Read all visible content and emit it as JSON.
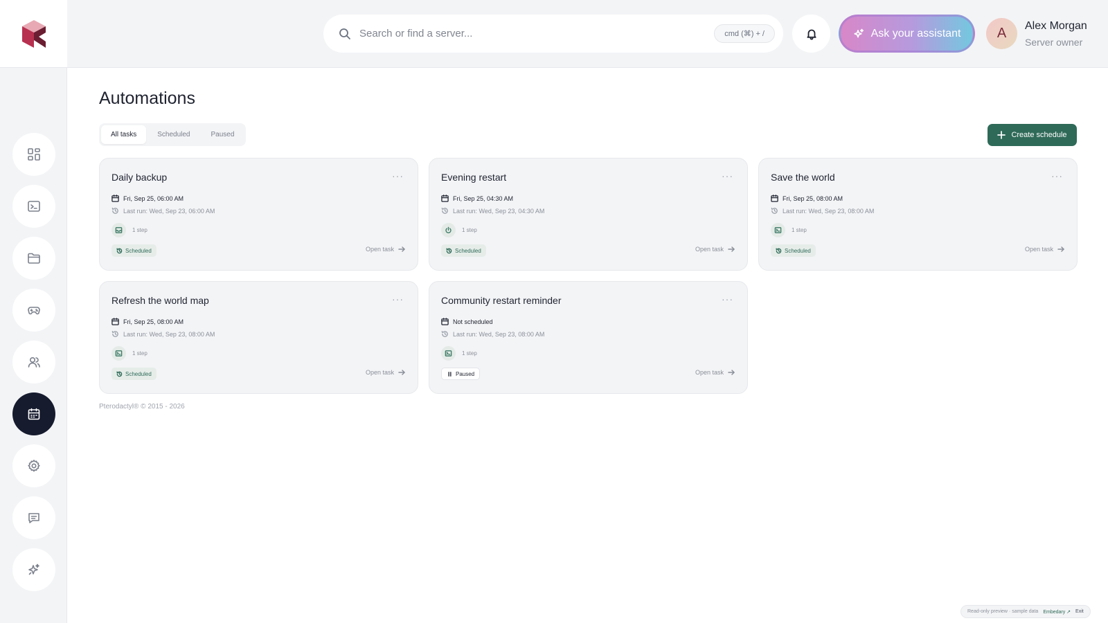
{
  "brand": {
    "logo_icon": "pterodactyl-cube-logo",
    "accent": "#2f6a58",
    "dark": "#161b2e"
  },
  "search": {
    "placeholder": "Search or find a server...",
    "shortcut": "cmd (⌘) + /"
  },
  "header": {
    "assistant_label": "Ask your assistant"
  },
  "user": {
    "initial": "A",
    "name": "Alex Morgan",
    "role": "Server owner"
  },
  "sidebar": {
    "items": [
      {
        "name": "dashboard",
        "icon": "grid-icon"
      },
      {
        "name": "console",
        "icon": "terminal-icon"
      },
      {
        "name": "files",
        "icon": "folder-icon"
      },
      {
        "name": "games",
        "icon": "gamepad-icon"
      },
      {
        "name": "users",
        "icon": "users-icon"
      },
      {
        "name": "schedules",
        "icon": "calendar-icon",
        "active": true
      },
      {
        "name": "settings",
        "icon": "gear-icon"
      },
      {
        "name": "messages",
        "icon": "chat-icon"
      },
      {
        "name": "assistant",
        "icon": "sparkle-icon"
      }
    ]
  },
  "page": {
    "title": "Automations"
  },
  "tabs": [
    "All tasks",
    "Scheduled",
    "Paused"
  ],
  "actions": {
    "create_label": "Create schedule"
  },
  "tasks": [
    {
      "title": "Daily backup",
      "next_run": "Fri, Sep 25, 06:00 AM",
      "last_run": "Last run: Wed, Sep 23, 06:00 AM",
      "steps": "1 step",
      "step_icon": "archive-icon",
      "status": "Scheduled",
      "open": "Open task"
    },
    {
      "title": "Evening restart",
      "next_run": "Fri, Sep 25, 04:30 AM",
      "last_run": "Last run: Wed, Sep 23, 04:30 AM",
      "steps": "1 step",
      "step_icon": "power-icon",
      "status": "Scheduled",
      "open": "Open task"
    },
    {
      "title": "Save the world",
      "next_run": "Fri, Sep 25, 08:00 AM",
      "last_run": "Last run: Wed, Sep 23, 08:00 AM",
      "steps": "1 step",
      "step_icon": "terminal-icon",
      "status": "Scheduled",
      "open": "Open task"
    },
    {
      "title": "Refresh the world map",
      "next_run": "Fri, Sep 25, 08:00 AM",
      "last_run": "Last run: Wed, Sep 23, 08:00 AM",
      "steps": "1 step",
      "step_icon": "terminal-icon",
      "status": "Scheduled",
      "open": "Open task"
    },
    {
      "title": "Community restart reminder",
      "next_run": "Not scheduled",
      "last_run": "Last run: Wed, Sep 23, 08:00 AM",
      "steps": "1 step",
      "step_icon": "terminal-icon",
      "status": "Paused",
      "open": "Open task"
    }
  ],
  "footer": {
    "copyright": "Pterodactyl® © 2015 - 2026"
  },
  "preview": {
    "text": "Read-only preview · sample data",
    "link": "Embedary ↗",
    "exit": "Exit"
  }
}
